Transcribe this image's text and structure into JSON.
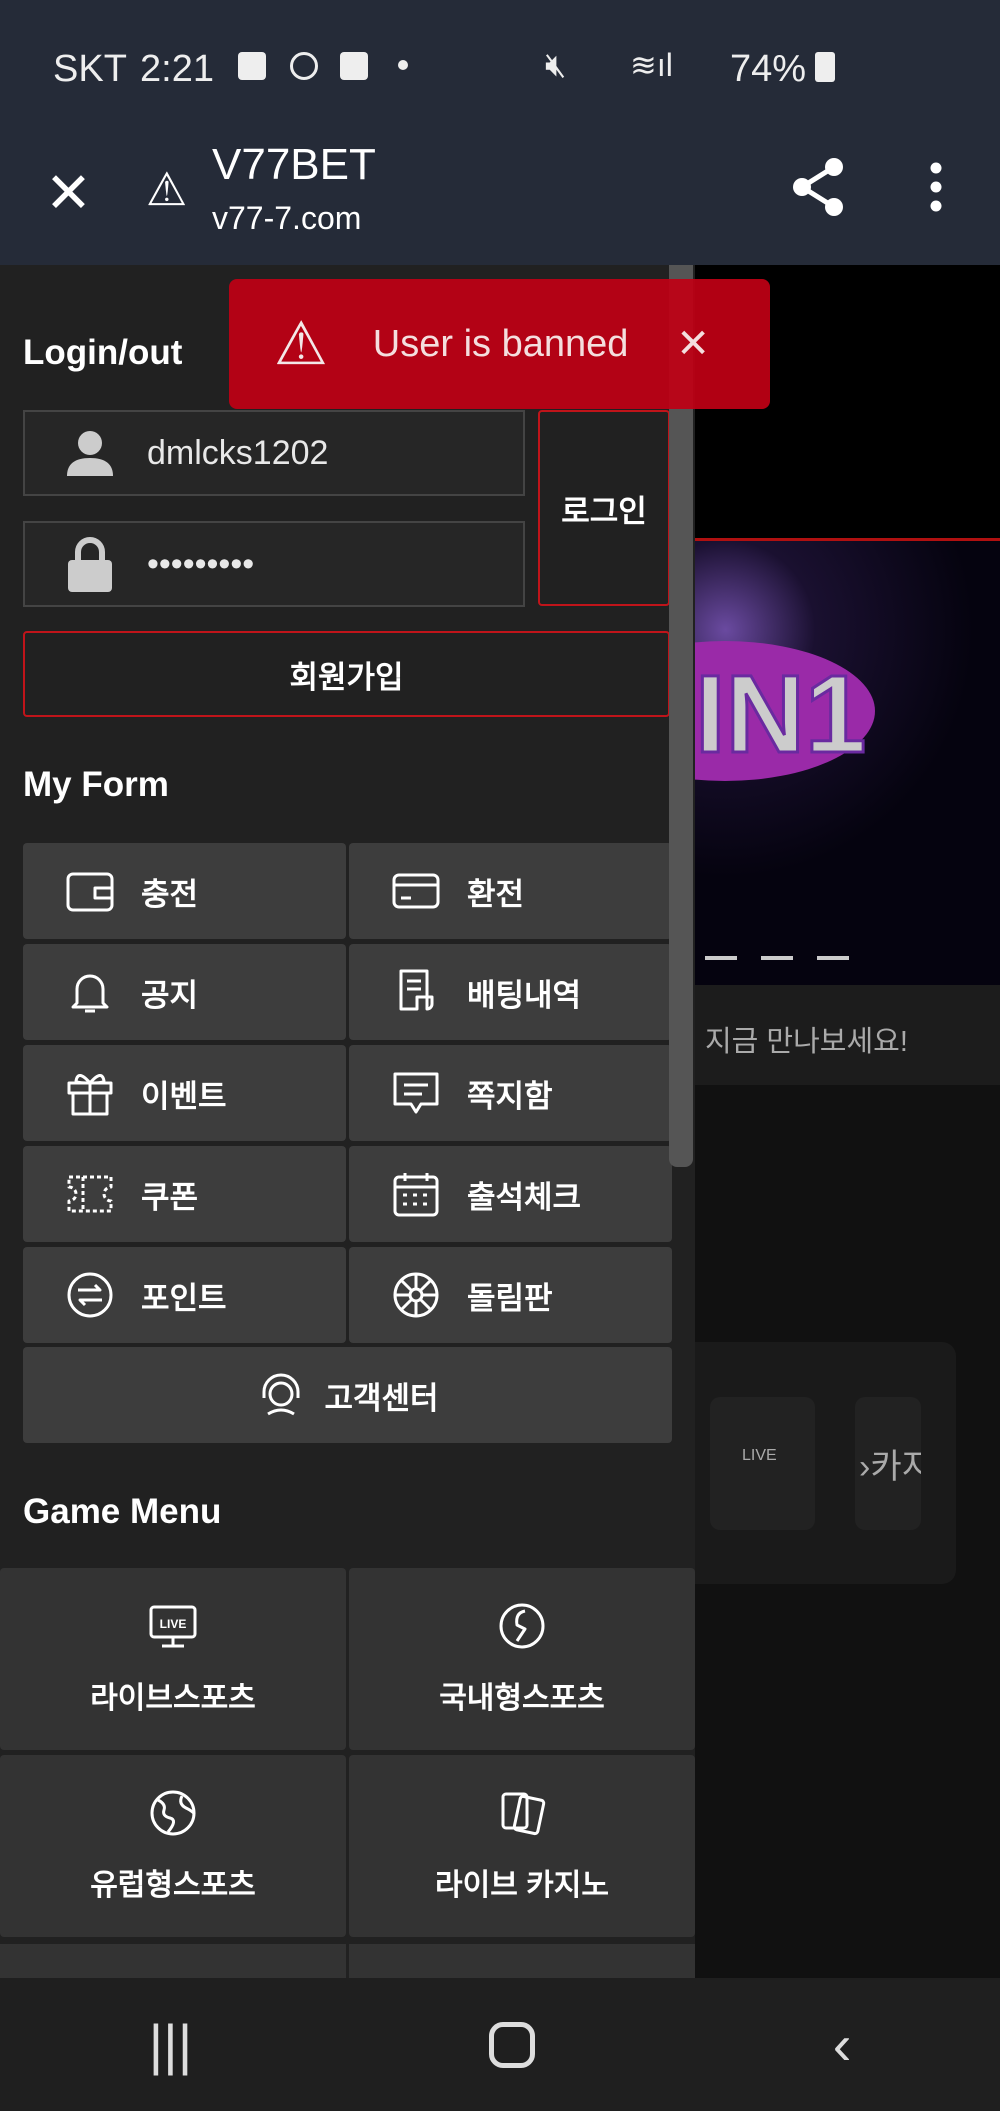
{
  "status_bar": {
    "carrier": "SKT",
    "time": "2:21",
    "battery": "74%"
  },
  "app_bar": {
    "title": "V77BET",
    "url": "v77-7.com"
  },
  "toast": {
    "message": "User is banned",
    "color": "#b5000f"
  },
  "login": {
    "heading": "Login/out",
    "username": "dmlcks1202",
    "password": "•••••••••",
    "login_label": "로그인",
    "signup_label": "회원가입"
  },
  "my_form": {
    "heading": "My Form",
    "items": [
      {
        "label": "충전",
        "icon": "wallet-icon"
      },
      {
        "label": "환전",
        "icon": "card-icon"
      },
      {
        "label": "공지",
        "icon": "bell-icon"
      },
      {
        "label": "배팅내역",
        "icon": "receipt-icon"
      },
      {
        "label": "이벤트",
        "icon": "gift-icon"
      },
      {
        "label": "쪽지함",
        "icon": "message-icon"
      },
      {
        "label": "쿠폰",
        "icon": "ticket-icon"
      },
      {
        "label": "출석체크",
        "icon": "calendar-icon"
      },
      {
        "label": "포인트",
        "icon": "points-icon"
      },
      {
        "label": "돌림판",
        "icon": "wheel-icon"
      }
    ],
    "support": "고객센터"
  },
  "game_menu": {
    "heading": "Game Menu",
    "items": [
      {
        "label": "라이브스포츠",
        "icon": "live-tv-icon"
      },
      {
        "label": "국내형스포츠",
        "icon": "sports-icon"
      },
      {
        "label": "유럽형스포츠",
        "icon": "globe-icon"
      },
      {
        "label": "라이브 카지노",
        "icon": "cards-icon"
      }
    ]
  },
  "background": {
    "banner_text": "IN1",
    "band_text": "지금 만나보세요!",
    "card_text": "카지"
  }
}
